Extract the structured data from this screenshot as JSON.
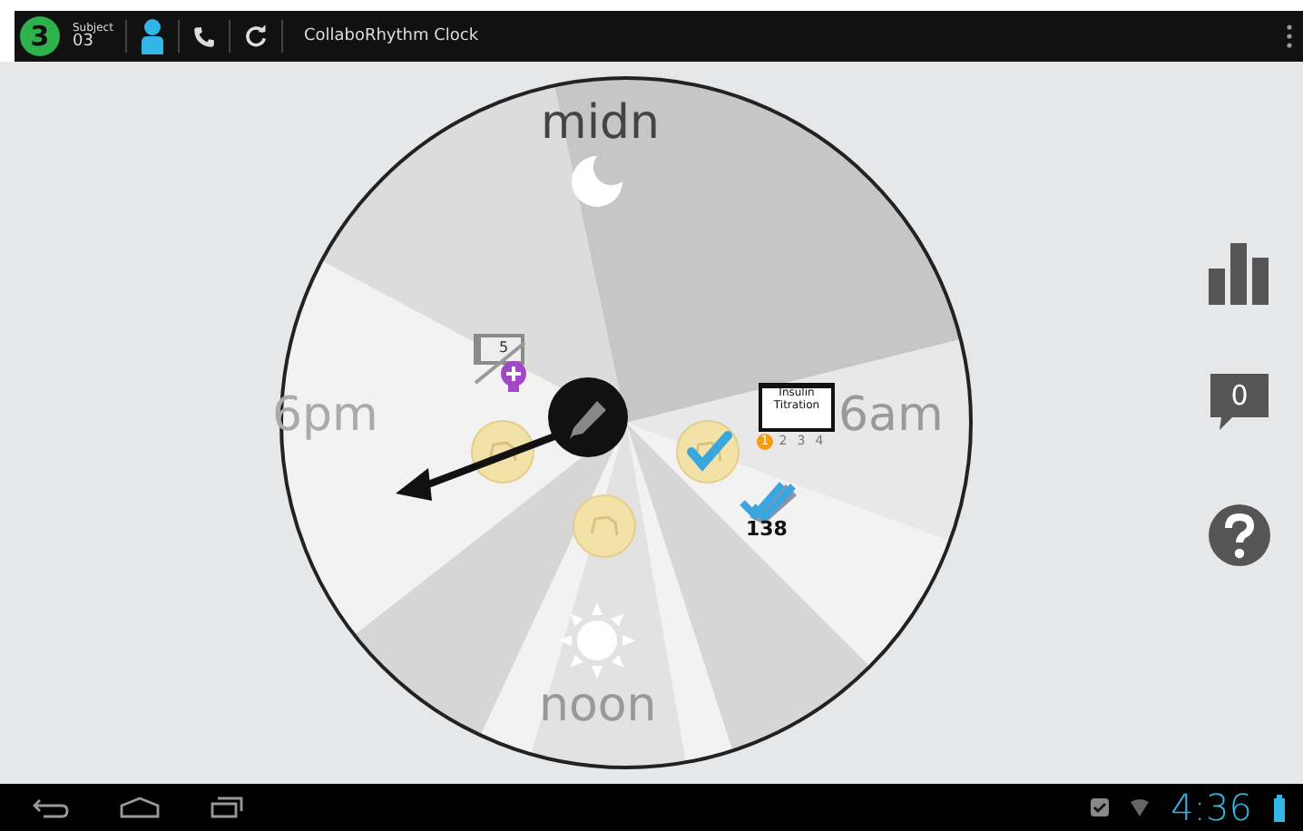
{
  "action_bar": {
    "subject_badge": "3",
    "subject_label": "Subject",
    "subject_number": "03",
    "title": "CollaboRhythm Clock"
  },
  "clock": {
    "labels": [
      {
        "kind": "top",
        "text": "midn"
      },
      {
        "kind": "right",
        "text": "6am"
      },
      {
        "kind": "bottom",
        "text": "noon"
      },
      {
        "kind": "left",
        "text": "6pm"
      }
    ],
    "note_count": "5",
    "titration": {
      "title": "Insulin Titration",
      "steps": [
        {
          "text": "1",
          "selected": true
        },
        {
          "text": "2",
          "selected": false
        },
        {
          "text": "3",
          "selected": false
        },
        {
          "text": "4",
          "selected": false
        }
      ]
    },
    "pills": [
      {
        "checked": false
      },
      {
        "checked": false
      },
      {
        "checked": true
      }
    ],
    "reading": "138"
  },
  "side": {
    "message_count": "0"
  },
  "system_bar": {
    "time": "4:36"
  }
}
